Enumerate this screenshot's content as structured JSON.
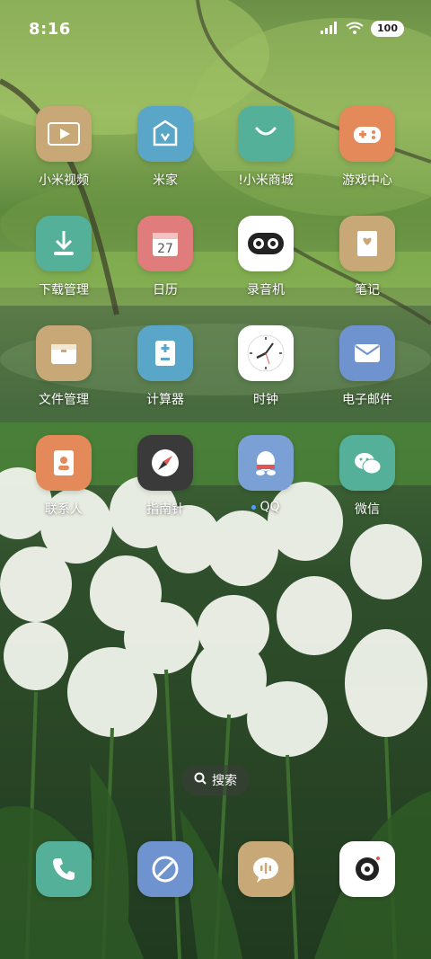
{
  "status_bar": {
    "time": "8:16",
    "battery": "100"
  },
  "apps": [
    {
      "label": "小米视频",
      "icon": "video-play-icon"
    },
    {
      "label": "米家",
      "icon": "mi-home-icon"
    },
    {
      "label": "!小米商城",
      "icon": "shopping-bag-icon"
    },
    {
      "label": "游戏中心",
      "icon": "gamepad-icon"
    },
    {
      "label": "下载管理",
      "icon": "download-icon"
    },
    {
      "label": "日历",
      "icon": "calendar-icon",
      "date": "27"
    },
    {
      "label": "录音机",
      "icon": "recorder-icon"
    },
    {
      "label": "笔记",
      "icon": "notes-icon"
    },
    {
      "label": "文件管理",
      "icon": "folder-icon"
    },
    {
      "label": "计算器",
      "icon": "calculator-icon"
    },
    {
      "label": "时钟",
      "icon": "clock-icon"
    },
    {
      "label": "电子邮件",
      "icon": "mail-icon"
    },
    {
      "label": "联系人",
      "icon": "contacts-icon"
    },
    {
      "label": "指南针",
      "icon": "compass-icon"
    },
    {
      "label": "QQ",
      "icon": "qq-penguin-icon",
      "has_notification_dot": true
    },
    {
      "label": "微信",
      "icon": "wechat-icon"
    }
  ],
  "search": {
    "label": "搜索"
  },
  "dock": [
    {
      "icon": "phone-icon"
    },
    {
      "icon": "browser-icon"
    },
    {
      "icon": "messages-icon"
    },
    {
      "icon": "camera-icon"
    }
  ],
  "colors": {
    "tan": "#c9a878",
    "teal_blue": "#5aa6c8",
    "mint": "#55b09a",
    "orange": "#e3895a",
    "pink": "#e07c7c",
    "white": "#ffffff",
    "slate_blue": "#6f93cf",
    "dark": "#3a3a3a",
    "qq_blue": "#7aa0d6"
  }
}
